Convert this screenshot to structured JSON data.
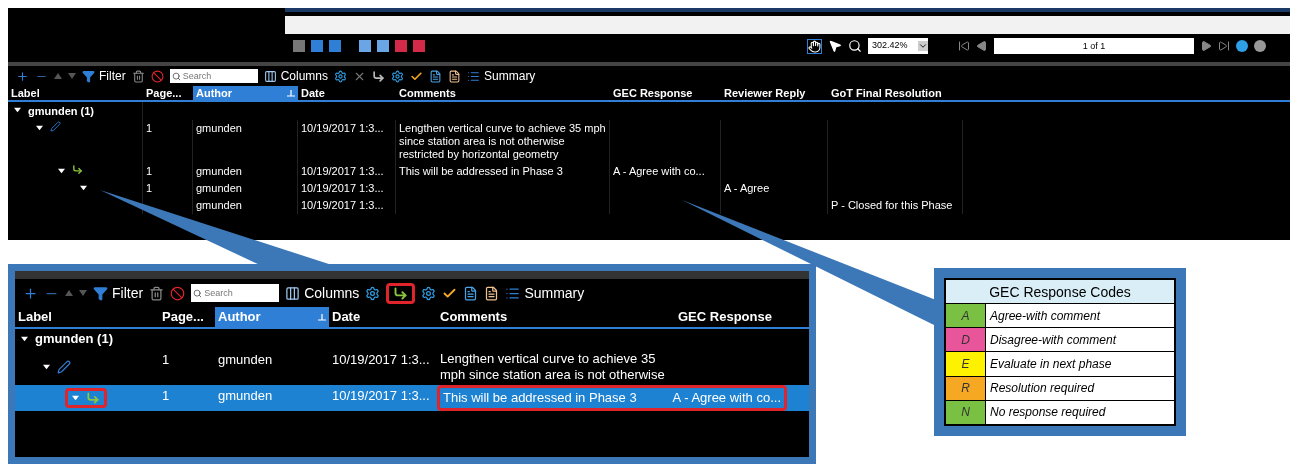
{
  "viewer_toolbar": {
    "zoom": "302.42%",
    "page": "1 of 1"
  },
  "markups_toolbar": {
    "filter": "Filter",
    "search_placeholder": "Search",
    "columns": "Columns",
    "summary": "Summary"
  },
  "table": {
    "columns": [
      {
        "label": "Label",
        "sorted": false
      },
      {
        "label": "Page...",
        "sorted": false
      },
      {
        "label": "Author",
        "sorted": true
      },
      {
        "label": "Date",
        "sorted": false
      },
      {
        "label": "Comments",
        "sorted": false
      },
      {
        "label": "GEC Response",
        "sorted": false
      },
      {
        "label": "Reviewer Reply",
        "sorted": false
      },
      {
        "label": "GoT Final Resolution",
        "sorted": false
      }
    ],
    "rows": [
      {
        "kind": "group",
        "label": "gmunden (1)",
        "expanded": true,
        "children": [
          {
            "kind": "pen",
            "expanded": true,
            "cells": [
              "1",
              "gmunden",
              "10/19/2017 1:3...",
              "Lengthen vertical curve to achieve 35 mph since station area is not otherwise restricted by horizontal geometry",
              "",
              "",
              ""
            ],
            "children": [
              {
                "kind": "reply",
                "expanded": true,
                "cells": [
                  "1",
                  "gmunden",
                  "10/19/2017 1:3...",
                  "This will be addressed in Phase 3",
                  "A - Agree with co...",
                  "",
                  ""
                ],
                "children": [
                  {
                    "expanded": true,
                    "cells": [
                      "1",
                      "gmunden",
                      "10/19/2017 1:3...",
                      "",
                      "",
                      "A - Agree",
                      ""
                    ],
                    "children": [
                      {
                        "cells": [
                          "",
                          "gmunden",
                          "10/19/2017 1:3...",
                          "",
                          "",
                          "",
                          "P - Closed for this Phase"
                        ]
                      }
                    ]
                  }
                ]
              }
            ]
          }
        ]
      }
    ]
  },
  "inset": {
    "toolbar": {
      "filter": "Filter",
      "search_placeholder": "Search",
      "columns": "Columns",
      "summary": "Summary",
      "reply_highlighted": true
    },
    "columns": [
      {
        "label": "Label",
        "sorted": false
      },
      {
        "label": "Page...",
        "sorted": false
      },
      {
        "label": "Author",
        "sorted": true
      },
      {
        "label": "Date",
        "sorted": false
      },
      {
        "label": "Comments",
        "sorted": false
      },
      {
        "label": "GEC Response",
        "sorted": false
      }
    ],
    "rows": [
      {
        "kind": "group",
        "label": "gmunden (1)",
        "selected": false,
        "highlighted": false
      },
      {
        "kind": "pen",
        "selected": false,
        "highlighted": false,
        "cells": [
          "1",
          "gmunden",
          "10/19/2017 1:3...",
          "Lengthen vertical curve to achieve 35 mph since station area is not otherwise",
          ""
        ]
      },
      {
        "kind": "reply",
        "selected": true,
        "highlighted": true,
        "cells": [
          "1",
          "gmunden",
          "10/19/2017 1:3...",
          "This will be addressed in Phase 3",
          "A - Agree with co..."
        ]
      }
    ]
  },
  "legend": {
    "title": "GEC Response Codes",
    "codes": [
      {
        "code": "A",
        "label": "Agree-with comment",
        "color": "#7ac143"
      },
      {
        "code": "D",
        "label": "Disagree-with comment",
        "color": "#e8559a"
      },
      {
        "code": "E",
        "label": "Evaluate in next phase",
        "color": "#fff200"
      },
      {
        "code": "R",
        "label": "Resolution required",
        "color": "#f7a823"
      },
      {
        "code": "N",
        "label": "No response required",
        "color": "#7ac143"
      }
    ]
  }
}
